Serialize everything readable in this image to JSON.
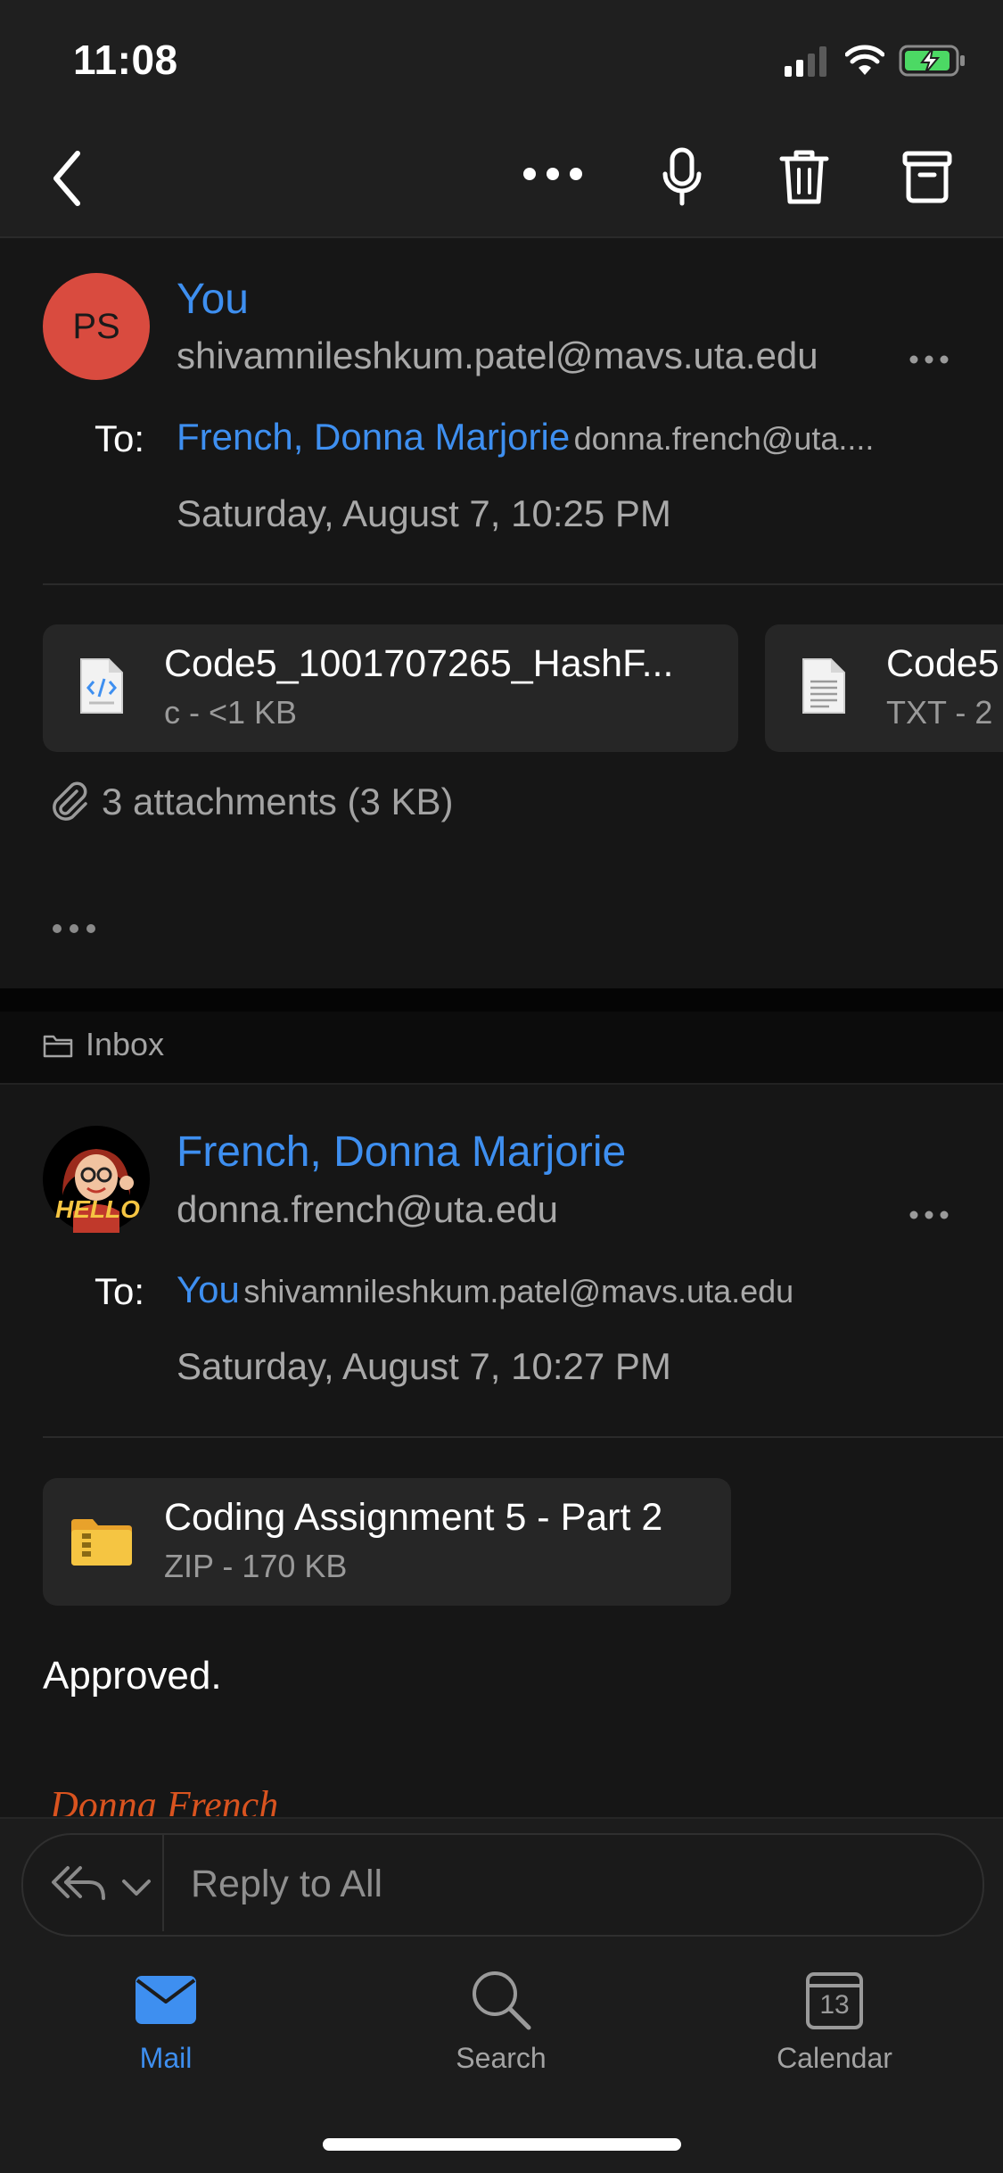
{
  "status_bar": {
    "time": "11:08"
  },
  "toolbar": {
    "back_icon": "chevron-left-icon",
    "more_icon": "ellipsis-icon",
    "mic_icon": "microphone-icon",
    "delete_icon": "trash-icon",
    "archive_icon": "archive-icon"
  },
  "message1": {
    "avatar_initials": "PS",
    "sender_name": "You",
    "sender_email": "shivamnileshkum.patel@mavs.uta.edu",
    "to_label": "To:",
    "to_name": "French, Donna Marjorie",
    "to_email": "donna.french@uta....",
    "date": "Saturday, August 7, 10:25 PM",
    "attachments": [
      {
        "name": "Code5_1001707265_HashF...",
        "meta": "c - <1 KB",
        "icon": "code-file-icon"
      },
      {
        "name": "Code5",
        "meta": "TXT - 2",
        "icon": "text-file-icon"
      }
    ],
    "attachments_summary": "3 attachments (3 KB)",
    "more_dots": "•••"
  },
  "folder": {
    "label": "Inbox"
  },
  "message2": {
    "avatar_text": "HELLO",
    "sender_name": "French, Donna Marjorie",
    "sender_email": "donna.french@uta.edu",
    "to_label": "To:",
    "to_name": "You",
    "to_email": "shivamnileshkum.patel@mavs.uta.edu",
    "date": "Saturday, August 7, 10:27 PM",
    "attachment": {
      "name": "Coding Assignment 5 - Part 2",
      "meta": "ZIP - 170 KB",
      "icon": "zip-folder-icon"
    },
    "body": "Approved.",
    "signature": "Donna French"
  },
  "reply": {
    "placeholder": "Reply to All"
  },
  "tabs": [
    {
      "label": "Mail",
      "icon": "mail-icon",
      "active": true
    },
    {
      "label": "Search",
      "icon": "search-icon",
      "active": false
    },
    {
      "label": "Calendar",
      "icon": "calendar-icon",
      "active": false,
      "day": "13"
    }
  ],
  "colors": {
    "accent": "#3e8ff0",
    "avatar": "#d94b3f",
    "background": "#161616"
  }
}
